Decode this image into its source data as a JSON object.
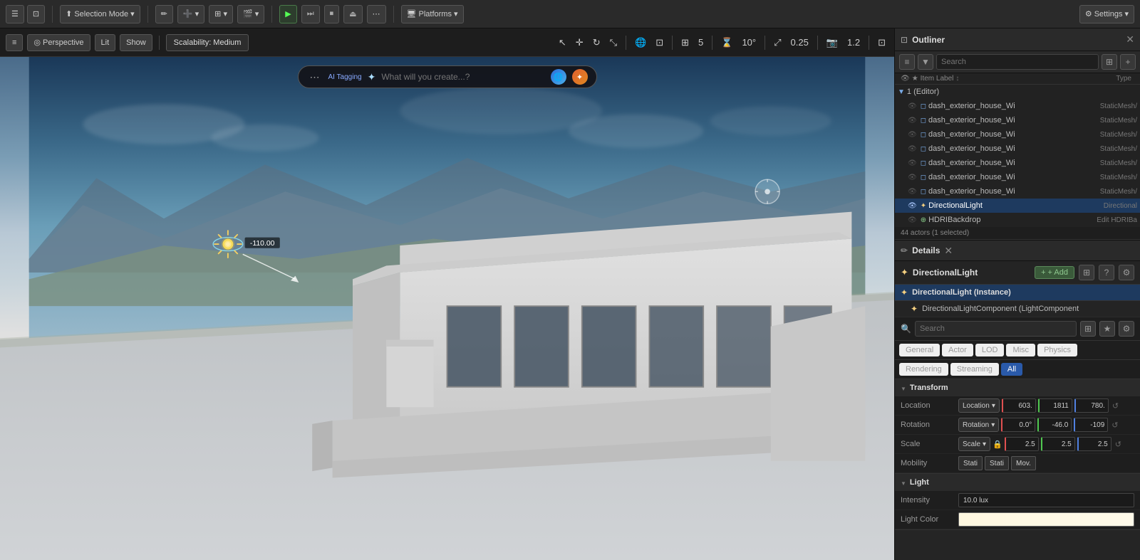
{
  "toolbar": {
    "selection_mode_label": "Selection Mode",
    "play_label": "▶",
    "pause_label": "⏸",
    "stop_label": "⏹",
    "eject_label": "⏏",
    "more_label": "⋯",
    "platforms_label": "Platforms",
    "settings_label": "Settings"
  },
  "viewport": {
    "perspective_label": "Perspective",
    "lit_label": "Lit",
    "show_label": "Show",
    "scalability_label": "Scalability: Medium",
    "ai_placeholder": "What will you create...?",
    "ai_tag_label": "AI Tagging",
    "light_value": "-110.00",
    "num5": "5",
    "angle": "10°",
    "scale_val": "0.25",
    "num12": "1.2"
  },
  "outliner": {
    "title": "Outliner",
    "search_placeholder": "Search",
    "col_item_label": "Item Label",
    "col_type": "Type",
    "actor_group": "1 (Editor)",
    "items": [
      {
        "name": "dash_exterior_house_Wi",
        "type": "StaticMesh/",
        "indent": 1
      },
      {
        "name": "dash_exterior_house_Wi",
        "type": "StaticMesh/",
        "indent": 1
      },
      {
        "name": "dash_exterior_house_Wi",
        "type": "StaticMesh/",
        "indent": 1
      },
      {
        "name": "dash_exterior_house_Wi",
        "type": "StaticMesh/",
        "indent": 1
      },
      {
        "name": "dash_exterior_house_Wi",
        "type": "StaticMesh/",
        "indent": 1
      },
      {
        "name": "dash_exterior_house_Wi",
        "type": "StaticMesh/",
        "indent": 1
      },
      {
        "name": "dash_exterior_house_Wi",
        "type": "StaticMesh/",
        "indent": 1
      },
      {
        "name": "DirectionalLight",
        "type": "Directional",
        "indent": 1,
        "selected": true
      },
      {
        "name": "HDRIBackdrop",
        "type": "Edit HDRIBa",
        "indent": 1
      }
    ],
    "actors_count": "44 actors (1 selected)"
  },
  "details": {
    "title": "Details",
    "component_name": "DirectionalLight",
    "add_label": "+ Add",
    "instance_label": "DirectionalLight (Instance)",
    "sub_instance_label": "DirectionalLightComponent (LightComponent",
    "search_placeholder": "Search",
    "filter_tabs": [
      "General",
      "Actor",
      "LOD",
      "Misc",
      "Physics"
    ],
    "filter_tabs2": [
      "Rendering",
      "Streaming",
      "All"
    ],
    "active_tab2": "All",
    "sections": {
      "transform": {
        "title": "Transform",
        "location_label": "Location",
        "location_x": "603.",
        "location_y": "1811",
        "location_z": "780.",
        "rotation_label": "Rotation",
        "rotation_x": "0.0°",
        "rotation_y": "-46.0",
        "rotation_z": "-109",
        "scale_label": "Scale",
        "scale_x": "2.5",
        "scale_y": "2.5",
        "scale_z": "2.5",
        "mobility_label": "Mobility",
        "mobility_static": "Stati",
        "mobility_stationary": "Stati",
        "mobility_movable": "Mov."
      },
      "light": {
        "title": "Light",
        "intensity_label": "Intensity",
        "intensity_value": "10.0 lux",
        "light_color_label": "Light Color"
      }
    }
  }
}
